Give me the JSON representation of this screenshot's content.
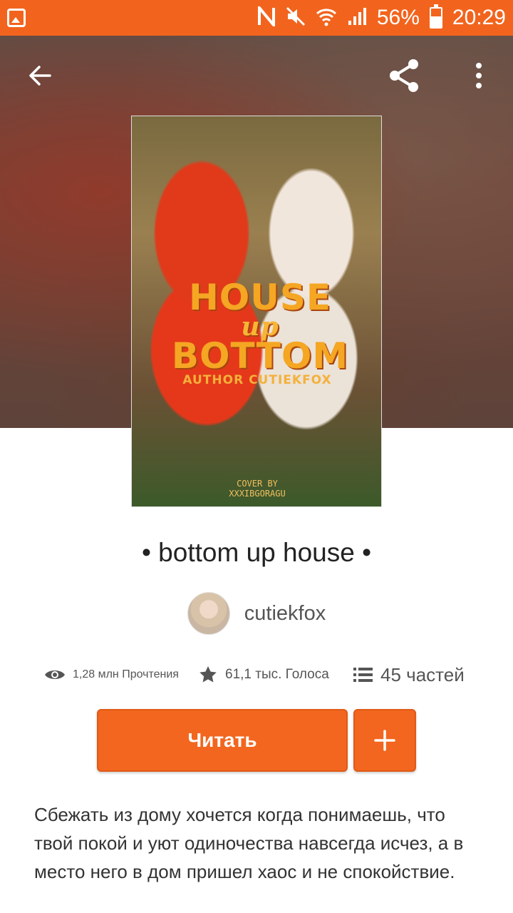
{
  "status_bar": {
    "battery": "56%",
    "time": "20:29",
    "battery_level": 0.56,
    "icons": [
      "gallery-icon",
      "nfc-icon",
      "mute-icon",
      "wifi-icon",
      "signal-icon",
      "battery-icon"
    ]
  },
  "toolbar": {
    "icons": [
      "back-arrow-icon",
      "share-icon",
      "more-vert-icon"
    ]
  },
  "cover": {
    "title_line1": "HOUSE",
    "title_line2": "up",
    "title_line3": "BOTTOM",
    "author_text": "AUTHOR CUTIEKFOX",
    "credit_line1": "COVER BY",
    "credit_line2": "XXXIBGORAGU"
  },
  "story": {
    "title": "• bottom up house •",
    "author": "cutiekfox"
  },
  "stats": {
    "reads": "1,28 млн Прочтения",
    "votes": "61,1 тыс. Голоса",
    "parts": "45 частей"
  },
  "actions": {
    "read_label": "Читать",
    "add_label": "+"
  },
  "description": "Сбежать из дому хочется когда понимаешь, что твой покой и уют одиночества навсегда исчез, а в место него в дом пришел хаос и не спокойствие.",
  "colors": {
    "accent": "#f2661f",
    "status_bar": "#f2641d"
  }
}
